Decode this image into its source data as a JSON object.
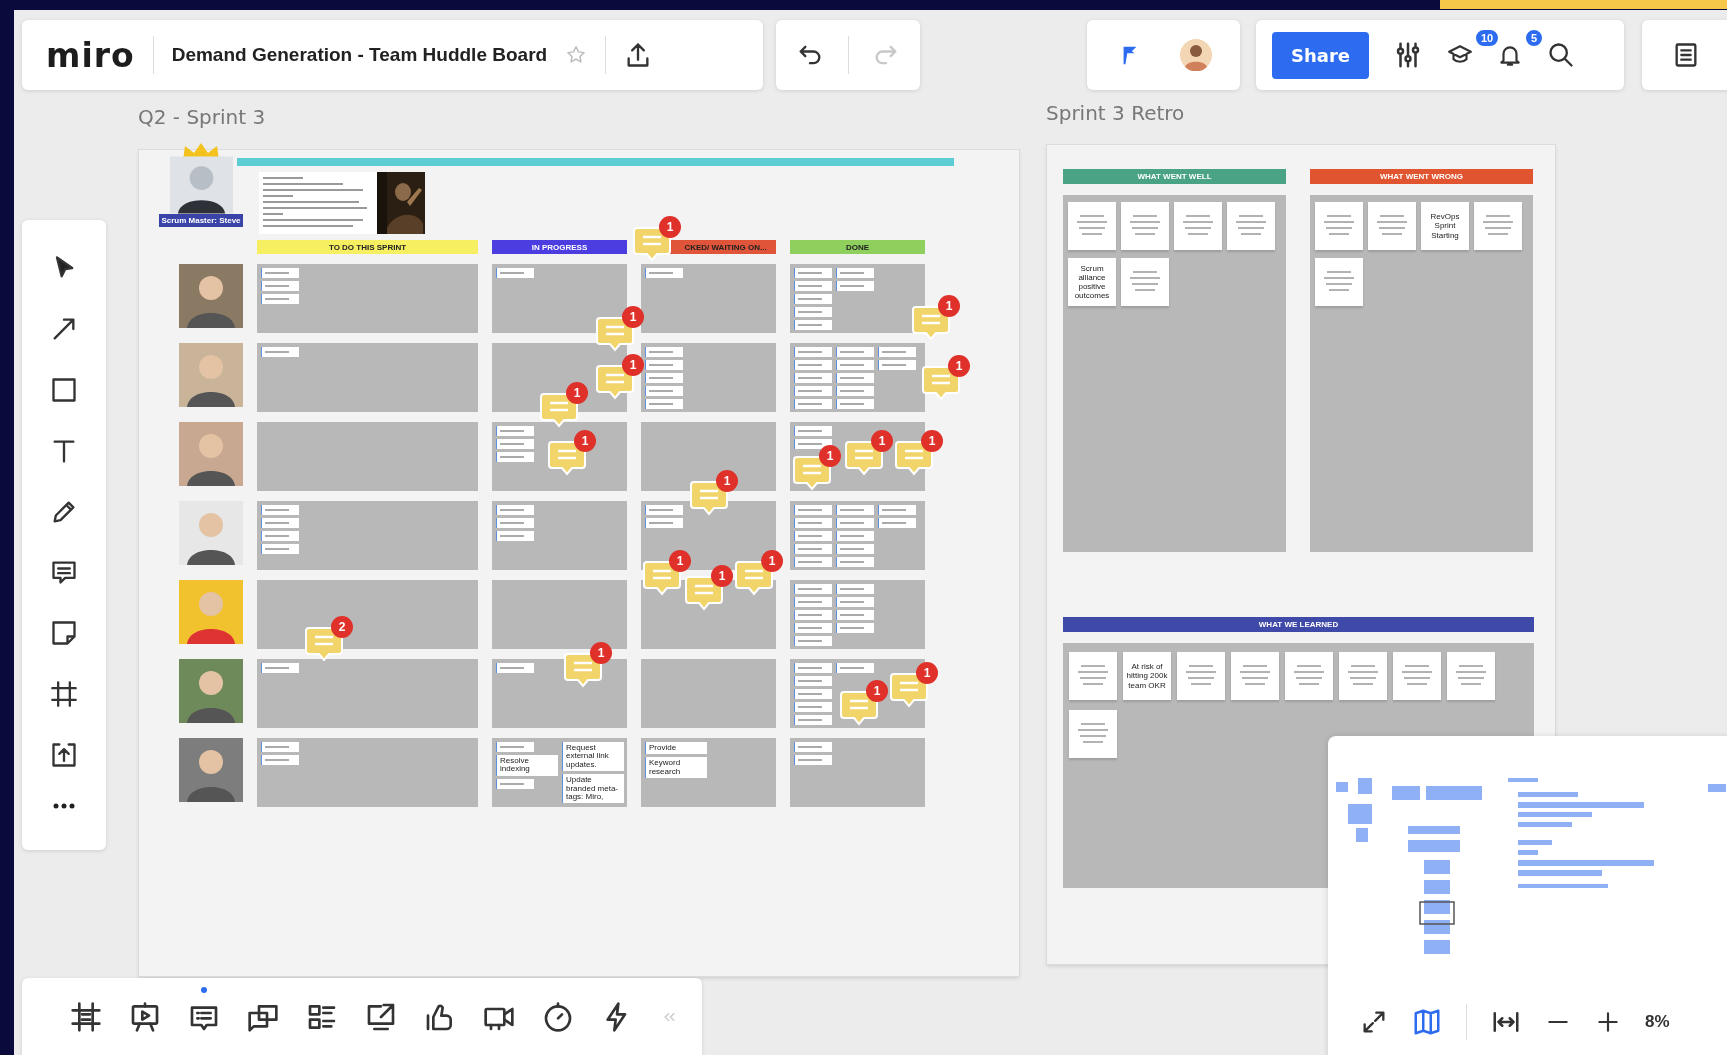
{
  "topbar": {
    "logo": "miro",
    "board_title": "Demand Generation - Team Huddle Board",
    "starred": false,
    "redo_disabled": true,
    "share_label": "Share",
    "notifications": [
      {
        "kind": "cap",
        "count": "10"
      },
      {
        "kind": "bell",
        "count": "5"
      }
    ]
  },
  "sprint_board": {
    "title": "Q2 - Sprint 3",
    "scrum_master": "Scrum Master: Steve",
    "columns": [
      {
        "label": "TO DO THIS SPRINT",
        "color": "#f7ef62"
      },
      {
        "label": "IN PROGRESS",
        "color": "#4b3de0"
      },
      {
        "label": "CKED/ WAITING ON...",
        "color": "#e0543a"
      },
      {
        "label": "DONE",
        "color": "#8fcf5d"
      }
    ],
    "rows": [
      {
        "cells": [
          {
            "notes": [
              {
                "kind": "scribble"
              },
              {
                "kind": "scribble"
              },
              {
                "kind": "scribble"
              }
            ]
          },
          {
            "notes": [
              {
                "kind": "scribble"
              }
            ]
          },
          {
            "notes": [
              {
                "kind": "scribble"
              }
            ]
          },
          {
            "notes": [
              {
                "kind": "scribble"
              },
              {
                "kind": "scribble"
              },
              {
                "kind": "scribble"
              },
              {
                "kind": "scribble"
              },
              {
                "kind": "scribble"
              },
              {
                "kind": "scribble"
              },
              {
                "kind": "scribble"
              }
            ]
          }
        ]
      },
      {
        "cells": [
          {
            "notes": [
              {
                "kind": "scribble"
              }
            ]
          },
          {},
          {
            "notes": [
              {
                "kind": "scribble"
              },
              {
                "kind": "scribble"
              },
              {
                "kind": "scribble"
              },
              {
                "kind": "scribble"
              },
              {
                "kind": "scribble"
              }
            ]
          },
          {
            "notes": [
              {
                "kind": "scribble"
              },
              {
                "kind": "scribble"
              },
              {
                "kind": "scribble"
              },
              {
                "kind": "scribble"
              },
              {
                "kind": "scribble"
              },
              {
                "kind": "scribble"
              },
              {
                "kind": "scribble"
              },
              {
                "kind": "scribble"
              },
              {
                "kind": "scribble"
              },
              {
                "kind": "scribble"
              },
              {
                "kind": "scribble"
              },
              {
                "kind": "scribble"
              }
            ]
          }
        ]
      },
      {
        "cells": [
          {},
          {
            "notes": [
              {
                "kind": "scribble"
              },
              {
                "kind": "scribble"
              },
              {
                "kind": "scribble"
              }
            ]
          },
          {},
          {
            "notes": [
              {
                "kind": "scribble"
              },
              {
                "kind": "scribble"
              }
            ]
          }
        ]
      },
      {
        "cells": [
          {
            "notes": [
              {
                "kind": "scribble"
              },
              {
                "kind": "scribble"
              },
              {
                "kind": "scribble"
              },
              {
                "kind": "scribble"
              }
            ]
          },
          {
            "notes": [
              {
                "kind": "scribble"
              },
              {
                "kind": "scribble"
              },
              {
                "kind": "scribble"
              }
            ]
          },
          {
            "notes": [
              {
                "kind": "scribble"
              },
              {
                "kind": "scribble"
              }
            ]
          },
          {
            "notes": [
              {
                "kind": "scribble"
              },
              {
                "kind": "scribble"
              },
              {
                "kind": "scribble"
              },
              {
                "kind": "scribble"
              },
              {
                "kind": "scribble"
              },
              {
                "kind": "scribble"
              },
              {
                "kind": "scribble"
              },
              {
                "kind": "scribble"
              },
              {
                "kind": "scribble"
              },
              {
                "kind": "scribble"
              },
              {
                "kind": "scribble"
              },
              {
                "kind": "scribble"
              }
            ]
          }
        ]
      },
      {
        "cells": [
          {},
          {},
          {},
          {
            "notes": [
              {
                "kind": "scribble"
              },
              {
                "kind": "scribble"
              },
              {
                "kind": "scribble"
              },
              {
                "kind": "scribble"
              },
              {
                "kind": "scribble"
              },
              {
                "kind": "scribble"
              },
              {
                "kind": "scribble"
              },
              {
                "kind": "scribble"
              },
              {
                "kind": "scribble"
              }
            ]
          }
        ]
      },
      {
        "cells": [
          {
            "notes": [
              {
                "kind": "scribble"
              }
            ]
          },
          {
            "notes": [
              {
                "kind": "scribble"
              }
            ]
          },
          {},
          {
            "notes": [
              {
                "kind": "scribble"
              },
              {
                "kind": "scribble"
              },
              {
                "kind": "scribble"
              },
              {
                "kind": "scribble"
              },
              {
                "kind": "scribble"
              },
              {
                "kind": "scribble"
              }
            ]
          }
        ]
      },
      {
        "cells": [
          {
            "notes": [
              {
                "kind": "scribble"
              },
              {
                "kind": "scribble"
              }
            ]
          },
          {
            "notes": [
              {
                "kind": "scribble"
              },
              {
                "kind": "text",
                "text": "Resolve indexing"
              },
              {
                "kind": "scribble"
              },
              {
                "kind": "text",
                "text": "Request external link updates."
              },
              {
                "kind": "text",
                "text": "Update branded meta-tags: Miro,"
              }
            ]
          },
          {
            "notes": [
              {
                "kind": "text",
                "text": "Provide"
              },
              {
                "kind": "text",
                "text": "Keyword research"
              }
            ]
          },
          {
            "notes": [
              {
                "kind": "scribble"
              },
              {
                "kind": "scribble"
              }
            ]
          }
        ]
      }
    ],
    "comments": [
      {
        "count": "1"
      },
      {
        "count": "1"
      },
      {
        "count": "1"
      },
      {
        "count": "1"
      },
      {
        "count": "1"
      },
      {
        "count": "1"
      },
      {
        "count": "1"
      },
      {
        "count": "1"
      },
      {
        "count": "1"
      },
      {
        "count": "1"
      },
      {
        "count": "1"
      },
      {
        "count": "1"
      },
      {
        "count": "1"
      },
      {
        "count": "1"
      },
      {
        "count": "2"
      },
      {
        "count": "1"
      },
      {
        "count": "1"
      },
      {
        "count": "1"
      }
    ]
  },
  "retro_board": {
    "title": "Sprint 3 Retro",
    "sections": [
      {
        "label": "WHAT WENT WELL",
        "color": "#4aa384",
        "notes": [
          {
            "kind": "scribble"
          },
          {
            "kind": "scribble"
          },
          {
            "kind": "scribble"
          },
          {
            "kind": "scribble"
          },
          {
            "kind": "text",
            "text": "Scrum alliance positive outcomes"
          },
          {
            "kind": "scribble"
          }
        ]
      },
      {
        "label": "WHAT WENT WRONG",
        "color": "#e0552f",
        "notes": [
          {
            "kind": "scribble"
          },
          {
            "kind": "scribble"
          },
          {
            "kind": "text",
            "text": "RevOps Sprint Starting"
          },
          {
            "kind": "scribble"
          },
          {
            "kind": "scribble"
          }
        ]
      },
      {
        "label": "WHAT WE LEARNED",
        "color": "#3f49a8",
        "notes": [
          {
            "kind": "scribble"
          },
          {
            "kind": "text",
            "text": "At risk of hitting 200k team OKR"
          },
          {
            "kind": "scribble"
          },
          {
            "kind": "scribble"
          },
          {
            "kind": "scribble"
          },
          {
            "kind": "scribble"
          },
          {
            "kind": "scribble"
          },
          {
            "kind": "scribble"
          },
          {
            "kind": "scribble"
          }
        ]
      }
    ]
  },
  "minimap": {
    "on": true,
    "zoom_level": "8%"
  },
  "bottom_toolbar": {
    "comment_notification": true
  }
}
